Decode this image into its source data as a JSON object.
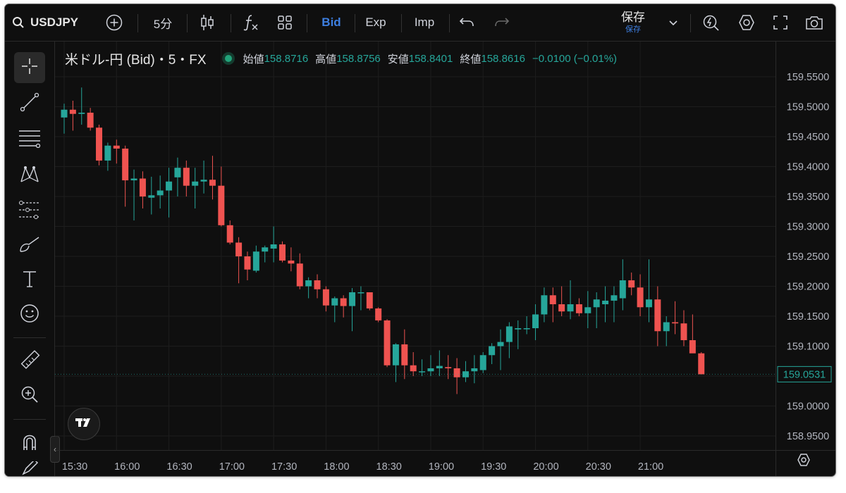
{
  "toolbar": {
    "symbol": "USDJPY",
    "interval": "5分",
    "bid_label": "Bid",
    "exp_label": "Exp",
    "imp_label": "Imp",
    "save_label": "保存",
    "save_sub_label": "保存"
  },
  "legend": {
    "title": "米ドル-円 (Bid)・5・FX",
    "open_label": "始値",
    "open_value": "158.8716",
    "high_label": "高値",
    "high_value": "158.8756",
    "low_label": "安値",
    "low_value": "158.8401",
    "close_label": "終値",
    "close_value": "158.8616",
    "change": "−0.0100 (−0.01%)"
  },
  "colors": {
    "up": "#26a69a",
    "down": "#ef5350",
    "accent": "#3d7fe0",
    "background": "#0f0f0f"
  },
  "icons": [
    "add-indicator-icon",
    "candles-icon",
    "fx-icon",
    "layout-icon",
    "undo-icon",
    "redo-icon",
    "chevron-down-icon",
    "alert-icon",
    "settings-icon",
    "fullscreen-icon",
    "camera-icon",
    "crosshair-icon",
    "trend-line-icon",
    "fib-icon",
    "pattern-icon",
    "forecast-icon",
    "brush-icon",
    "text-icon",
    "emoji-icon",
    "ruler-icon",
    "zoom-in-icon",
    "magnet-icon",
    "pencil-icon",
    "tradingview-logo-icon"
  ],
  "chart_data": {
    "type": "candlestick",
    "y_axis": {
      "ticks": [
        "159.5500",
        "159.5000",
        "159.4500",
        "159.4000",
        "159.3500",
        "159.3000",
        "159.2500",
        "159.2000",
        "159.1500",
        "159.1000",
        "159.0500",
        "159.0000",
        "158.9500"
      ],
      "ylim": [
        158.93,
        159.58
      ]
    },
    "x_axis": {
      "ticks": [
        "15:30",
        "16:00",
        "16:30",
        "17:00",
        "17:30",
        "18:00",
        "18:30",
        "19:00",
        "19:30",
        "20:00",
        "20:30",
        "21:00"
      ]
    },
    "last_price_label": "159.0531",
    "grid": true,
    "candles": [
      {
        "t": "15:30",
        "o": 159.482,
        "h": 159.505,
        "l": 159.455,
        "c": 159.495
      },
      {
        "t": "15:35",
        "o": 159.495,
        "h": 159.51,
        "l": 159.46,
        "c": 159.488
      },
      {
        "t": "15:40",
        "o": 159.488,
        "h": 159.532,
        "l": 159.47,
        "c": 159.49
      },
      {
        "t": "15:45",
        "o": 159.49,
        "h": 159.498,
        "l": 159.46,
        "c": 159.465
      },
      {
        "t": "15:50",
        "o": 159.465,
        "h": 159.47,
        "l": 159.402,
        "c": 159.41
      },
      {
        "t": "15:55",
        "o": 159.41,
        "h": 159.44,
        "l": 159.393,
        "c": 159.435
      },
      {
        "t": "16:00",
        "o": 159.435,
        "h": 159.445,
        "l": 159.405,
        "c": 159.43
      },
      {
        "t": "16:05",
        "o": 159.43,
        "h": 159.435,
        "l": 159.333,
        "c": 159.377
      },
      {
        "t": "16:10",
        "o": 159.377,
        "h": 159.395,
        "l": 159.31,
        "c": 159.38
      },
      {
        "t": "16:15",
        "o": 159.38,
        "h": 159.392,
        "l": 159.33,
        "c": 159.35
      },
      {
        "t": "16:20",
        "o": 159.348,
        "h": 159.383,
        "l": 159.32,
        "c": 159.352
      },
      {
        "t": "16:25",
        "o": 159.352,
        "h": 159.385,
        "l": 159.33,
        "c": 159.36
      },
      {
        "t": "16:30",
        "o": 159.36,
        "h": 159.398,
        "l": 159.315,
        "c": 159.375
      },
      {
        "t": "16:35",
        "o": 159.382,
        "h": 159.415,
        "l": 159.35,
        "c": 159.398
      },
      {
        "t": "16:40",
        "o": 159.398,
        "h": 159.41,
        "l": 159.35,
        "c": 159.368
      },
      {
        "t": "16:45",
        "o": 159.368,
        "h": 159.398,
        "l": 159.33,
        "c": 159.375
      },
      {
        "t": "16:50",
        "o": 159.375,
        "h": 159.41,
        "l": 159.355,
        "c": 159.378
      },
      {
        "t": "16:55",
        "o": 159.378,
        "h": 159.418,
        "l": 159.345,
        "c": 159.368
      },
      {
        "t": "17:00",
        "o": 159.368,
        "h": 159.4,
        "l": 159.3,
        "c": 159.302
      },
      {
        "t": "17:05",
        "o": 159.302,
        "h": 159.31,
        "l": 159.27,
        "c": 159.273
      },
      {
        "t": "17:10",
        "o": 159.273,
        "h": 159.282,
        "l": 159.205,
        "c": 159.25
      },
      {
        "t": "17:15",
        "o": 159.25,
        "h": 159.258,
        "l": 159.21,
        "c": 159.228
      },
      {
        "t": "17:20",
        "o": 159.226,
        "h": 159.268,
        "l": 159.223,
        "c": 159.258
      },
      {
        "t": "17:25",
        "o": 159.258,
        "h": 159.268,
        "l": 159.24,
        "c": 159.265
      },
      {
        "t": "17:30",
        "o": 159.263,
        "h": 159.3,
        "l": 159.24,
        "c": 159.27
      },
      {
        "t": "17:35",
        "o": 159.27,
        "h": 159.275,
        "l": 159.24,
        "c": 159.243
      },
      {
        "t": "17:40",
        "o": 159.243,
        "h": 159.265,
        "l": 159.225,
        "c": 159.238
      },
      {
        "t": "17:45",
        "o": 159.238,
        "h": 159.255,
        "l": 159.195,
        "c": 159.2
      },
      {
        "t": "17:50",
        "o": 159.2,
        "h": 159.215,
        "l": 159.18,
        "c": 159.21
      },
      {
        "t": "17:55",
        "o": 159.21,
        "h": 159.22,
        "l": 159.18,
        "c": 159.195
      },
      {
        "t": "18:00",
        "o": 159.195,
        "h": 159.2,
        "l": 159.158,
        "c": 159.168
      },
      {
        "t": "18:05",
        "o": 159.168,
        "h": 159.183,
        "l": 159.14,
        "c": 159.18
      },
      {
        "t": "18:10",
        "o": 159.18,
        "h": 159.185,
        "l": 159.148,
        "c": 159.167
      },
      {
        "t": "18:15",
        "o": 159.167,
        "h": 159.197,
        "l": 159.125,
        "c": 159.19
      },
      {
        "t": "18:20",
        "o": 159.19,
        "h": 159.2,
        "l": 159.16,
        "c": 159.19
      },
      {
        "t": "18:25",
        "o": 159.19,
        "h": 159.19,
        "l": 159.16,
        "c": 159.163
      },
      {
        "t": "18:30",
        "o": 159.163,
        "h": 159.165,
        "l": 159.14,
        "c": 159.143
      },
      {
        "t": "18:35",
        "o": 159.143,
        "h": 159.145,
        "l": 159.065,
        "c": 159.068
      },
      {
        "t": "18:40",
        "o": 159.068,
        "h": 159.105,
        "l": 159.04,
        "c": 159.103
      },
      {
        "t": "18:45",
        "o": 159.103,
        "h": 159.128,
        "l": 159.045,
        "c": 159.068
      },
      {
        "t": "18:50",
        "o": 159.068,
        "h": 159.09,
        "l": 159.05,
        "c": 159.058
      },
      {
        "t": "18:55",
        "o": 159.058,
        "h": 159.078,
        "l": 159.05,
        "c": 159.058
      },
      {
        "t": "19:00",
        "o": 159.058,
        "h": 159.085,
        "l": 159.05,
        "c": 159.063
      },
      {
        "t": "19:05",
        "o": 159.063,
        "h": 159.093,
        "l": 159.05,
        "c": 159.067
      },
      {
        "t": "19:10",
        "o": 159.065,
        "h": 159.085,
        "l": 159.045,
        "c": 159.063
      },
      {
        "t": "19:15",
        "o": 159.063,
        "h": 159.08,
        "l": 159.02,
        "c": 159.048
      },
      {
        "t": "19:20",
        "o": 159.048,
        "h": 159.075,
        "l": 159.04,
        "c": 159.058
      },
      {
        "t": "19:25",
        "o": 159.058,
        "h": 159.085,
        "l": 159.038,
        "c": 159.063
      },
      {
        "t": "19:30",
        "o": 159.06,
        "h": 159.09,
        "l": 159.055,
        "c": 159.085
      },
      {
        "t": "19:35",
        "o": 159.085,
        "h": 159.105,
        "l": 159.07,
        "c": 159.1
      },
      {
        "t": "19:40",
        "o": 159.1,
        "h": 159.128,
        "l": 159.06,
        "c": 159.107
      },
      {
        "t": "19:45",
        "o": 159.107,
        "h": 159.14,
        "l": 159.08,
        "c": 159.133
      },
      {
        "t": "19:50",
        "o": 159.128,
        "h": 159.143,
        "l": 159.095,
        "c": 159.13
      },
      {
        "t": "19:55",
        "o": 159.13,
        "h": 159.15,
        "l": 159.12,
        "c": 159.13
      },
      {
        "t": "20:00",
        "o": 159.13,
        "h": 159.17,
        "l": 159.11,
        "c": 159.153
      },
      {
        "t": "20:05",
        "o": 159.153,
        "h": 159.198,
        "l": 159.14,
        "c": 159.185
      },
      {
        "t": "20:10",
        "o": 159.185,
        "h": 159.198,
        "l": 159.14,
        "c": 159.17
      },
      {
        "t": "20:15",
        "o": 159.17,
        "h": 159.2,
        "l": 159.15,
        "c": 159.158
      },
      {
        "t": "20:20",
        "o": 159.158,
        "h": 159.21,
        "l": 159.145,
        "c": 159.17
      },
      {
        "t": "20:25",
        "o": 159.17,
        "h": 159.18,
        "l": 159.15,
        "c": 159.155
      },
      {
        "t": "20:30",
        "o": 159.155,
        "h": 159.192,
        "l": 159.13,
        "c": 159.165
      },
      {
        "t": "20:35",
        "o": 159.165,
        "h": 159.19,
        "l": 159.13,
        "c": 159.178
      },
      {
        "t": "20:40",
        "o": 159.17,
        "h": 159.2,
        "l": 159.14,
        "c": 159.176
      },
      {
        "t": "20:45",
        "o": 159.176,
        "h": 159.2,
        "l": 159.14,
        "c": 159.185
      },
      {
        "t": "20:50",
        "o": 159.18,
        "h": 159.245,
        "l": 159.16,
        "c": 159.21
      },
      {
        "t": "20:55",
        "o": 159.21,
        "h": 159.223,
        "l": 159.185,
        "c": 159.198
      },
      {
        "t": "21:00",
        "o": 159.198,
        "h": 159.22,
        "l": 159.15,
        "c": 159.165
      },
      {
        "t": "21:05",
        "o": 159.165,
        "h": 159.245,
        "l": 159.14,
        "c": 159.178
      },
      {
        "t": "21:10",
        "o": 159.178,
        "h": 159.2,
        "l": 159.1,
        "c": 159.125
      },
      {
        "t": "21:15",
        "o": 159.125,
        "h": 159.15,
        "l": 159.1,
        "c": 159.14
      },
      {
        "t": "21:20",
        "o": 159.14,
        "h": 159.175,
        "l": 159.12,
        "c": 159.138
      },
      {
        "t": "21:25",
        "o": 159.138,
        "h": 159.16,
        "l": 159.1,
        "c": 159.11
      },
      {
        "t": "21:30",
        "o": 159.11,
        "h": 159.153,
        "l": 159.09,
        "c": 159.088
      },
      {
        "t": "21:35",
        "o": 159.088,
        "h": 159.09,
        "l": 159.053,
        "c": 159.053
      }
    ]
  }
}
